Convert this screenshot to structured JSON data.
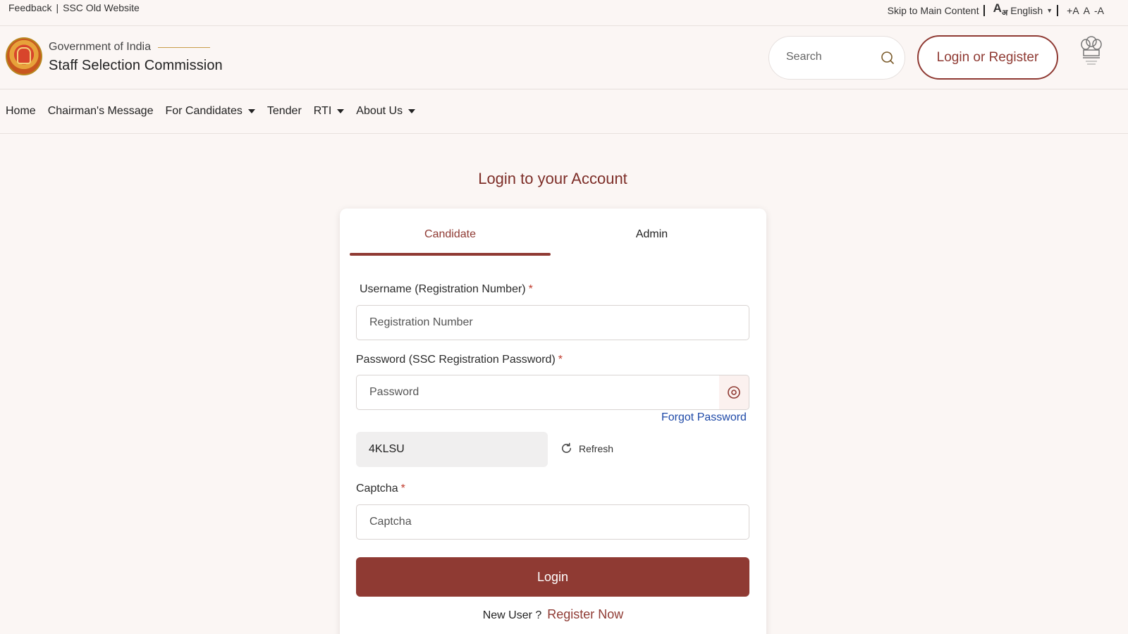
{
  "utility": {
    "feedback": "Feedback",
    "separator": "|",
    "old_website": "SSC Old Website",
    "skip_main": "Skip to Main Content",
    "language": "English",
    "font_increase": "+A",
    "font_normal": "A",
    "font_decrease": "-A"
  },
  "header": {
    "org_small": "Government of India",
    "org_name": "Staff Selection Commission",
    "search_placeholder": "Search",
    "login_register": "Login or Register"
  },
  "nav": {
    "items": [
      {
        "label": "Home",
        "dropdown": false
      },
      {
        "label": "Chairman's Message",
        "dropdown": false
      },
      {
        "label": "For Candidates",
        "dropdown": true
      },
      {
        "label": "Tender",
        "dropdown": false
      },
      {
        "label": "RTI",
        "dropdown": true
      },
      {
        "label": "About Us",
        "dropdown": true
      }
    ]
  },
  "login": {
    "title": "Login to your Account",
    "tabs": [
      {
        "label": "Candidate",
        "active": true
      },
      {
        "label": "Admin",
        "active": false
      }
    ],
    "username_label": "Username (Registration Number)",
    "username_placeholder": "Registration Number",
    "password_label": "Password (SSC Registration Password)",
    "password_placeholder": "Password",
    "forgot_password": "Forgot Password",
    "captcha_code": "4KLSU",
    "refresh_label": "Refresh",
    "captcha_label": "Captcha",
    "captcha_placeholder": "Captcha",
    "required_mark": "*",
    "login_button": "Login",
    "new_user_text": "New User ?",
    "register_now": "Register Now"
  },
  "colors": {
    "brand": "#8f3a33",
    "link": "#1f4aa8",
    "background": "#fbf6f4"
  }
}
